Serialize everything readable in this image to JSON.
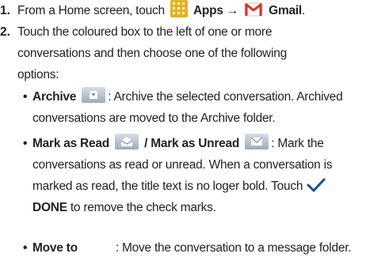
{
  "steps": [
    {
      "num": "1."
    },
    {
      "num": "2."
    }
  ],
  "step1": {
    "prefix": "From a Home screen, touch",
    "apps": "Apps",
    "arrow": "→",
    "gmail": "Gmail",
    "period": "."
  },
  "step2": {
    "line1": "Touch the coloured box to the left of one or more",
    "line2": "conversations and then choose one of the following",
    "line3": "options:"
  },
  "bullets": {
    "dot": "•",
    "archive": {
      "label": "Archive",
      "text1": ": Archive the selected conversation. Archived",
      "text2": "conversations are moved to the Archive folder."
    },
    "mark": {
      "label_read": "Mark as Read",
      "slash": "/",
      "label_unread": "Mark as Unread",
      "text1": ": Mark the",
      "text2": "conversations as read or unread. When a conversation is",
      "text3": "marked as read, the title text is no loger bold. Touch",
      "done": "DONE",
      "text4": "to remove the check marks."
    },
    "move": {
      "label": "Move to",
      "text1": ": Move the conversation to a message folder."
    }
  },
  "colors": {
    "apps_icon": "#e8b120",
    "gmail_red": "#d93025",
    "button_icon_top": "#d7dee6",
    "button_icon_bottom": "#9eabb8",
    "check_mark": "#1a4f8a"
  }
}
